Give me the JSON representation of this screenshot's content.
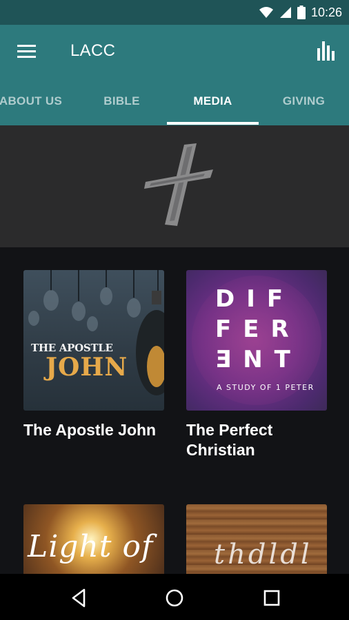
{
  "status_bar": {
    "time": "10:26",
    "icons": [
      "wifi-icon",
      "signal-icon",
      "battery-icon"
    ]
  },
  "app_bar": {
    "title": "LACC",
    "left_icon": "menu-icon",
    "right_icon": "bar-chart-icon"
  },
  "tabs": [
    {
      "label": "ABOUT US",
      "active": false
    },
    {
      "label": "BIBLE",
      "active": false
    },
    {
      "label": "MEDIA",
      "active": true
    },
    {
      "label": "GIVING",
      "active": false
    }
  ],
  "banner": {
    "logo": "cross-logo-icon"
  },
  "media_items": [
    {
      "title": "The Apostle John",
      "thumb_text_small": "THE APOSTLE",
      "thumb_text_big": "JOHN"
    },
    {
      "title": "The Perfect Christian",
      "thumb_lines": [
        "DIF",
        "FER",
        "ƎNT"
      ],
      "thumb_subtitle": "A STUDY OF 1 PETER"
    },
    {
      "title": "",
      "thumb_text": "Light of"
    },
    {
      "title": "",
      "thumb_text": "thdldl"
    }
  ],
  "colors": {
    "status_bar": "#1f5457",
    "app_bar": "#2d7a7d",
    "background": "#121316",
    "banner": "#2b2b2c",
    "john_gold": "#e6a94a"
  },
  "nav_bar": {
    "icons": [
      "back-icon",
      "home-icon",
      "recents-icon"
    ]
  }
}
